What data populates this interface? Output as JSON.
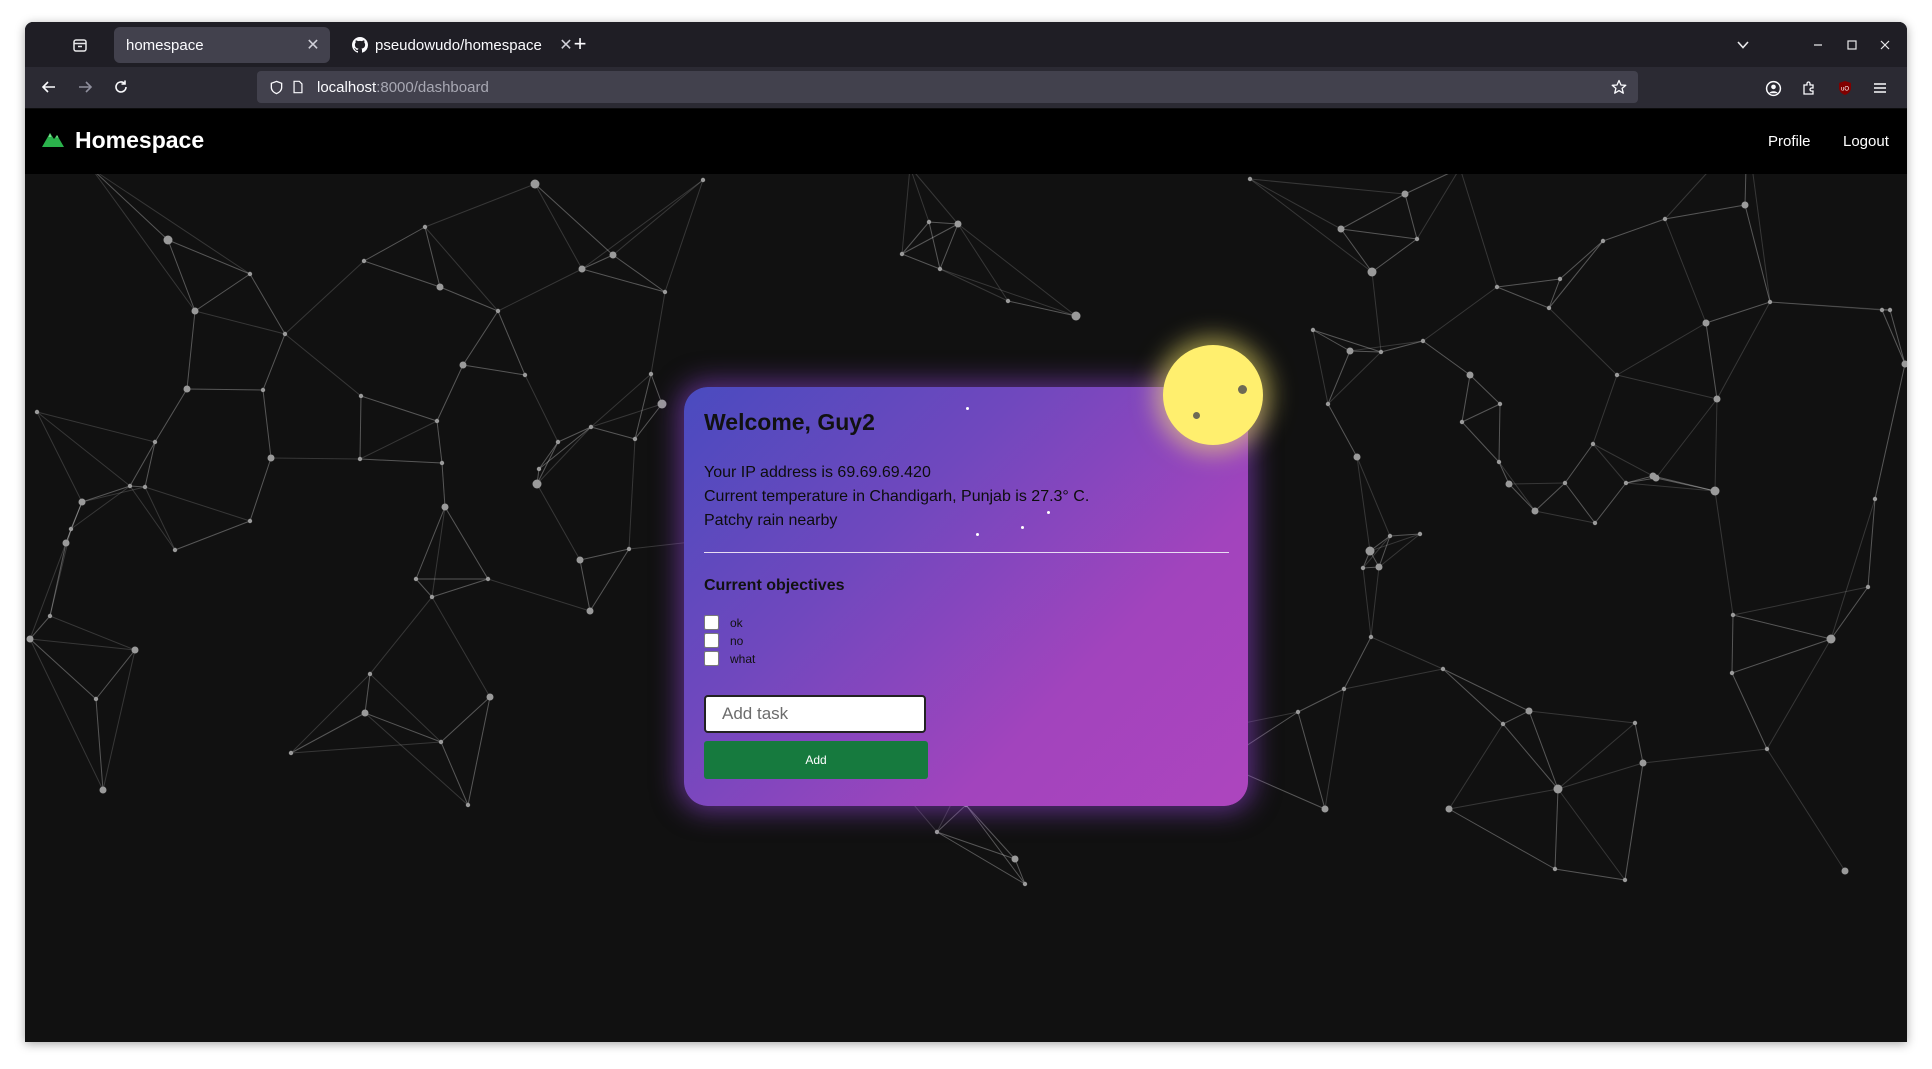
{
  "browser": {
    "tabs": [
      {
        "title": "homespace",
        "active": true
      },
      {
        "title": "pseudowudo/homespace",
        "active": false,
        "favicon": "github-icon"
      }
    ],
    "url": {
      "host": "localhost",
      "path": ":8000/dashboard"
    }
  },
  "site": {
    "brand": "Homespace",
    "brand_icon": "mountain-icon",
    "brand_color": "#2bb24c",
    "nav": {
      "profile": "Profile",
      "logout": "Logout"
    }
  },
  "card": {
    "welcome": "Welcome, Guy2",
    "ip_line": "Your IP address is 69.69.69.420",
    "temp_line": "Current temperature in Chandigarh, Punjab is 27.3° C.",
    "weather_line": "Patchy rain nearby",
    "objectives_title": "Current objectives",
    "tasks": [
      "ok",
      "no",
      "what"
    ],
    "task_input_placeholder": "Add task",
    "add_button": "Add"
  },
  "colors": {
    "card_gradient_start": "#4a4bbf",
    "card_gradient_end": "#ad45be",
    "moon": "#ffef6e",
    "add_button": "#167a3e",
    "page_background": "#111111"
  }
}
